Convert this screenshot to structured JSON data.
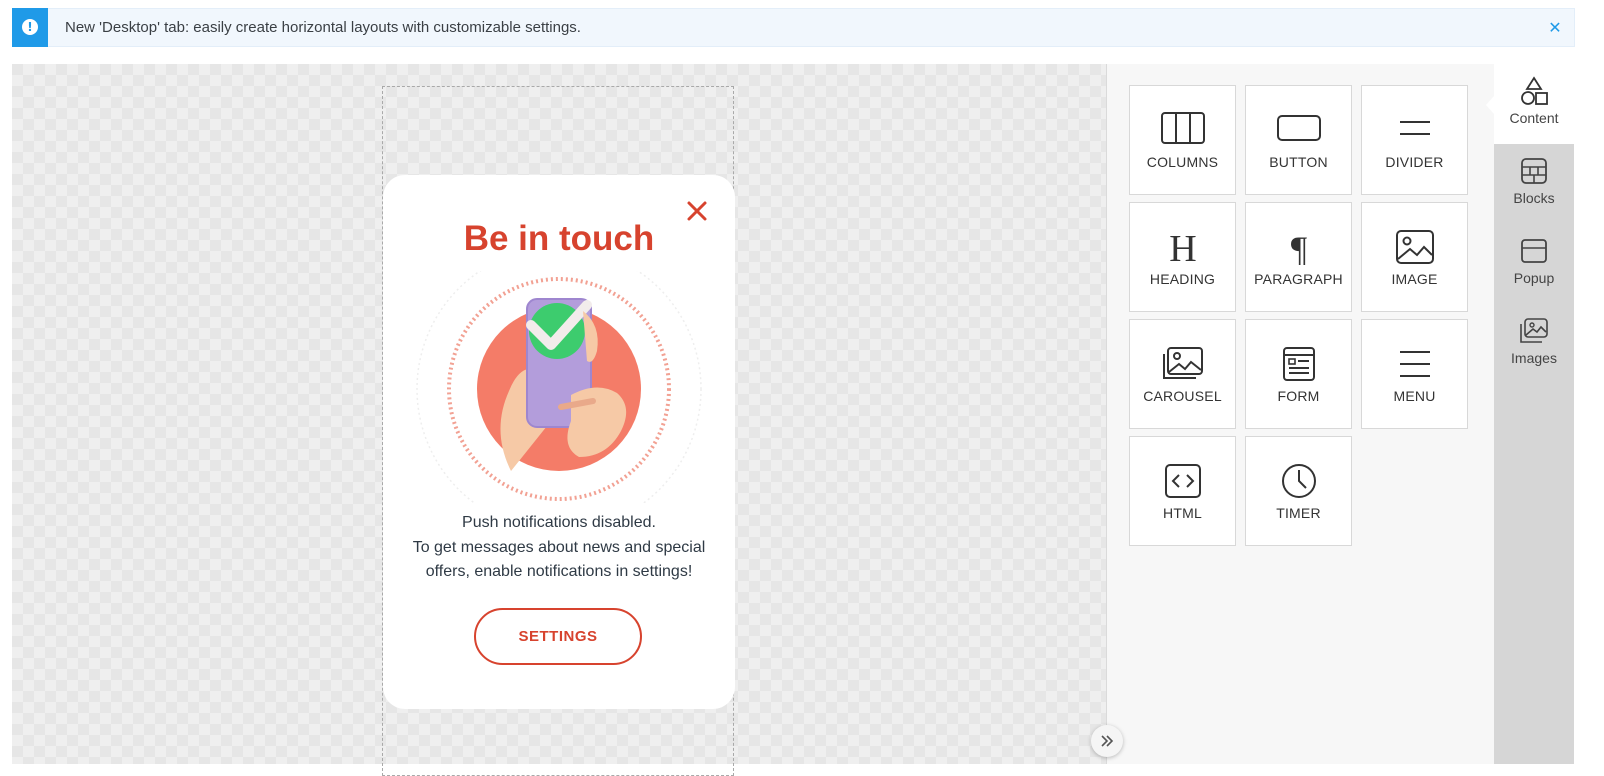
{
  "banner": {
    "text": "New 'Desktop' tab: easily create horizontal layouts with customizable settings.",
    "icon": "alert-icon",
    "close_icon": "close-icon",
    "accent_color": "#1f9ae8"
  },
  "popup": {
    "title": "Be in touch",
    "text_lines": [
      "Push notifications disabled.",
      "To get messages about news and special",
      "offers, enable notifications in settings!"
    ],
    "button_label": "SETTINGS",
    "accent_color": "#d7432e"
  },
  "content_tiles": [
    {
      "label": "COLUMNS",
      "icon": "columns-icon"
    },
    {
      "label": "BUTTON",
      "icon": "button-icon"
    },
    {
      "label": "DIVIDER",
      "icon": "divider-icon"
    },
    {
      "label": "HEADING",
      "icon": "heading-icon"
    },
    {
      "label": "PARAGRAPH",
      "icon": "paragraph-icon"
    },
    {
      "label": "IMAGE",
      "icon": "image-icon"
    },
    {
      "label": "CAROUSEL",
      "icon": "carousel-icon"
    },
    {
      "label": "FORM",
      "icon": "form-icon"
    },
    {
      "label": "MENU",
      "icon": "menu-icon"
    },
    {
      "label": "HTML",
      "icon": "html-icon"
    },
    {
      "label": "TIMER",
      "icon": "timer-icon"
    }
  ],
  "tabs": [
    {
      "label": "Content",
      "icon": "shapes-icon",
      "active": true
    },
    {
      "label": "Blocks",
      "icon": "blocks-icon",
      "active": false
    },
    {
      "label": "Popup",
      "icon": "popup-icon",
      "active": false
    },
    {
      "label": "Images",
      "icon": "images-icon",
      "active": false
    }
  ]
}
